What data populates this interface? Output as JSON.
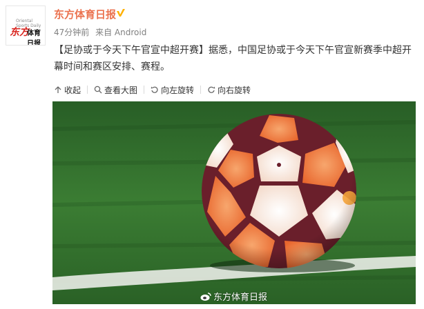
{
  "account": {
    "avatar_text_small": "Oriental Sports Daily",
    "avatar_brand_red": "东方",
    "avatar_brand_black": "体育日报",
    "name": "东方体育日报",
    "verify_icon": "verified-badge-icon",
    "verify_color": "#ffb100"
  },
  "meta": {
    "time": "47分钟前",
    "source": "来自 Android"
  },
  "post": {
    "title": "【足协或于今天下午官宣中超开赛】",
    "body": "据悉，中国足协或于今天下午官宣新赛季中超开幕时间和赛区安排、赛程。"
  },
  "toolbar": {
    "collapse": "收起",
    "view_large": "查看大图",
    "rotate_left": "向左旋转",
    "rotate_right": "向右旋转"
  },
  "photo": {
    "watermark": "东方体育日报",
    "subject": "football-on-grass"
  },
  "colors": {
    "name": "#eb7350",
    "grass": "#2f6e2c",
    "ball_orange": "#e8662d",
    "ball_maroon": "#6a1f2b"
  }
}
